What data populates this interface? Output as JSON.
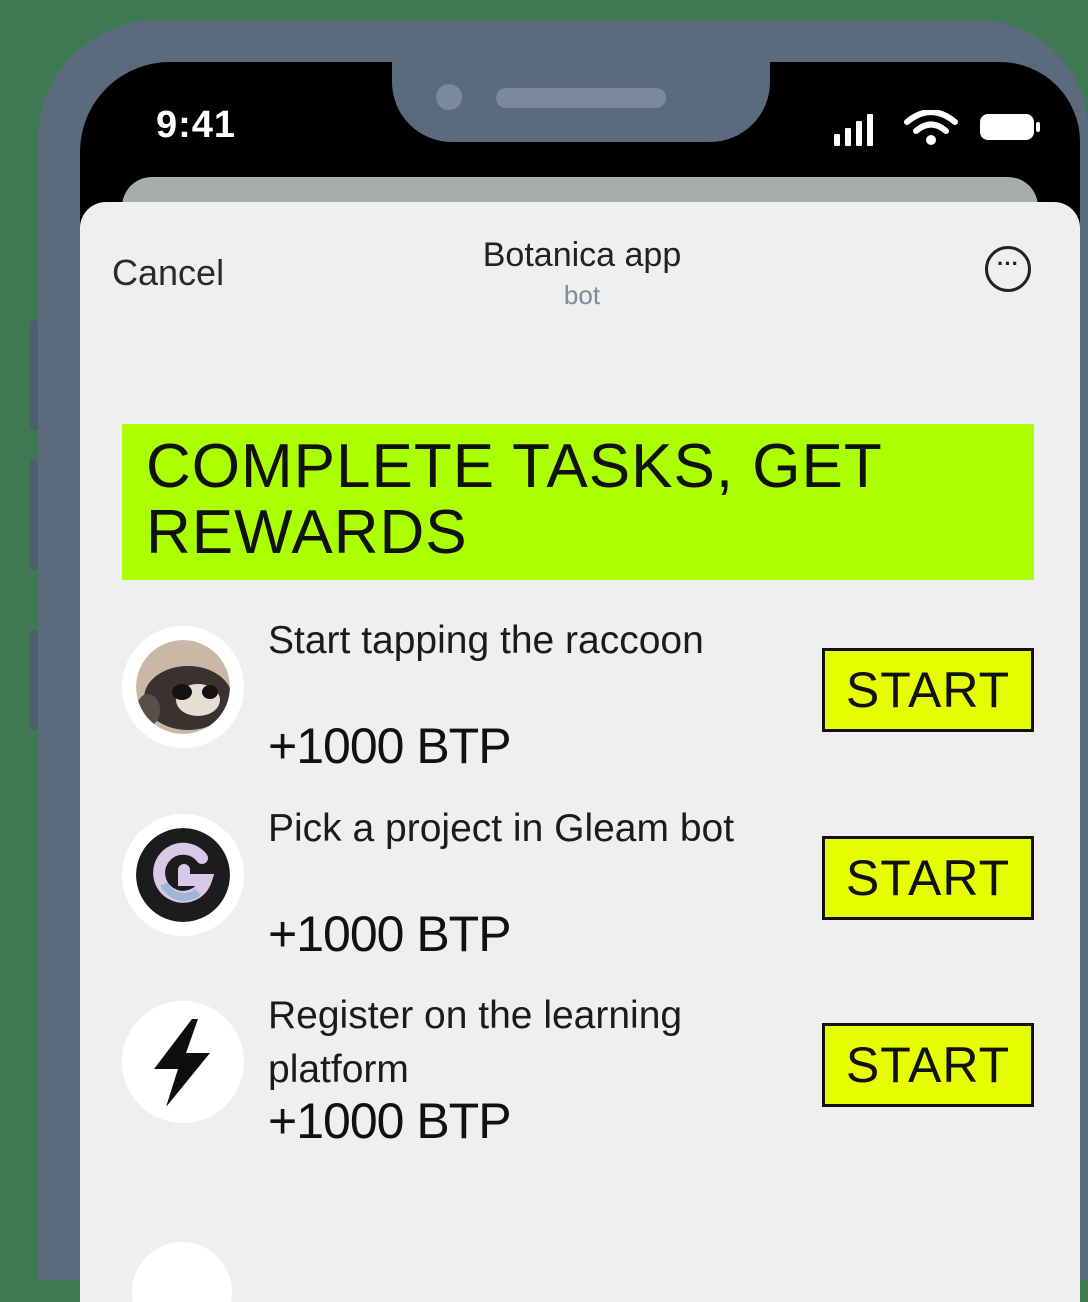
{
  "status_bar": {
    "time": "9:41"
  },
  "header": {
    "cancel_label": "Cancel",
    "title": "Botanica app",
    "subtitle": "bot",
    "more_label": "···"
  },
  "banner": {
    "title": "COMPLETE TASKS, GET REWARDS"
  },
  "tasks": [
    {
      "text": "Start tapping the raccoon",
      "reward": "+1000 BTP",
      "button": "START",
      "icon": "raccoon-icon"
    },
    {
      "text": "Pick a project in Gleam bot",
      "reward": "+1000 BTP",
      "button": "START",
      "icon": "gleam-logo-icon"
    },
    {
      "text": "Register on the learning platform",
      "reward": "+1000 BTP",
      "button": "START",
      "icon": "lightning-bolt-icon"
    }
  ],
  "colors": {
    "background": "#3d7a52",
    "banner": "#aaff00",
    "button": "#e5ff00",
    "sheet": "#efefef"
  }
}
